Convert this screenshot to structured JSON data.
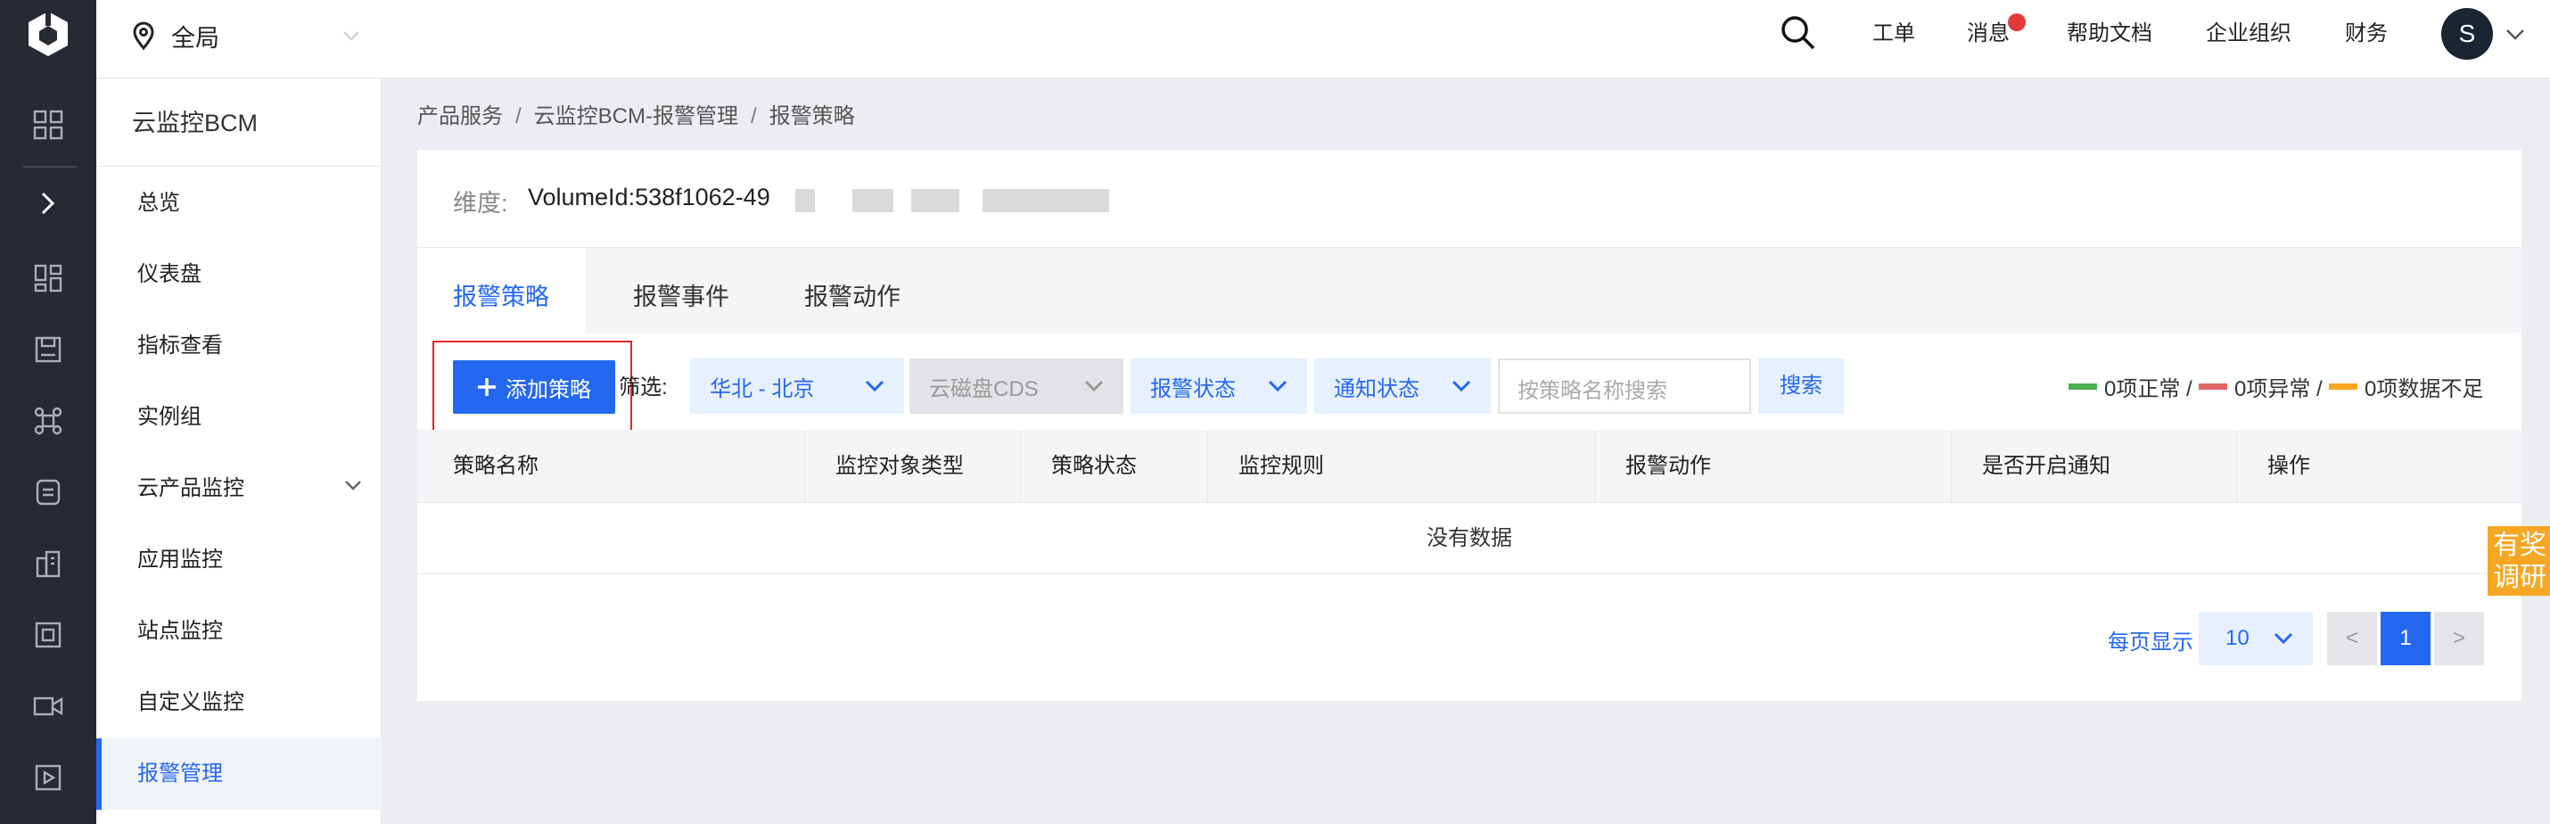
{
  "topbar": {
    "region": "全局",
    "nav": [
      "工单",
      "消息",
      "帮助文档",
      "企业组织",
      "财务"
    ],
    "avatar_initial": "S"
  },
  "menu": {
    "title": "云监控BCM",
    "items": [
      "总览",
      "仪表盘",
      "指标查看",
      "实例组",
      "云产品监控",
      "应用监控",
      "站点监控",
      "自定义监控",
      "报警管理"
    ]
  },
  "breadcrumb": [
    "产品服务",
    "云监控BCM-报警管理",
    "报警策略"
  ],
  "dimension": {
    "label": "维度:",
    "value": "VolumeId:538f1062-49"
  },
  "tabs": [
    "报警策略",
    "报警事件",
    "报警动作"
  ],
  "toolbar": {
    "add_label": "添加策略",
    "filter_label": "筛选:",
    "region_select": "华北 - 北京",
    "product_select": "云磁盘CDS",
    "alarm_status_select": "报警状态",
    "notify_status_select": "通知状态",
    "search_placeholder": "按策略名称搜索",
    "search_button": "搜索"
  },
  "legend": {
    "normal": "0项正常 /",
    "abnormal": "0项异常 /",
    "insufficient": "0项数据不足",
    "colors": {
      "normal": "#4caf50",
      "abnormal": "#e06666",
      "insufficient": "#f5a623"
    }
  },
  "table": {
    "columns": [
      "策略名称",
      "监控对象类型",
      "策略状态",
      "监控规则",
      "报警动作",
      "是否开启通知",
      "操作"
    ],
    "empty_text": "没有数据"
  },
  "pager": {
    "per_page_label": "每页显示",
    "per_page_value": "10",
    "prev": "<",
    "current": "1",
    "next": ">"
  },
  "survey": "有奖调研",
  "accent": "#2468f2"
}
